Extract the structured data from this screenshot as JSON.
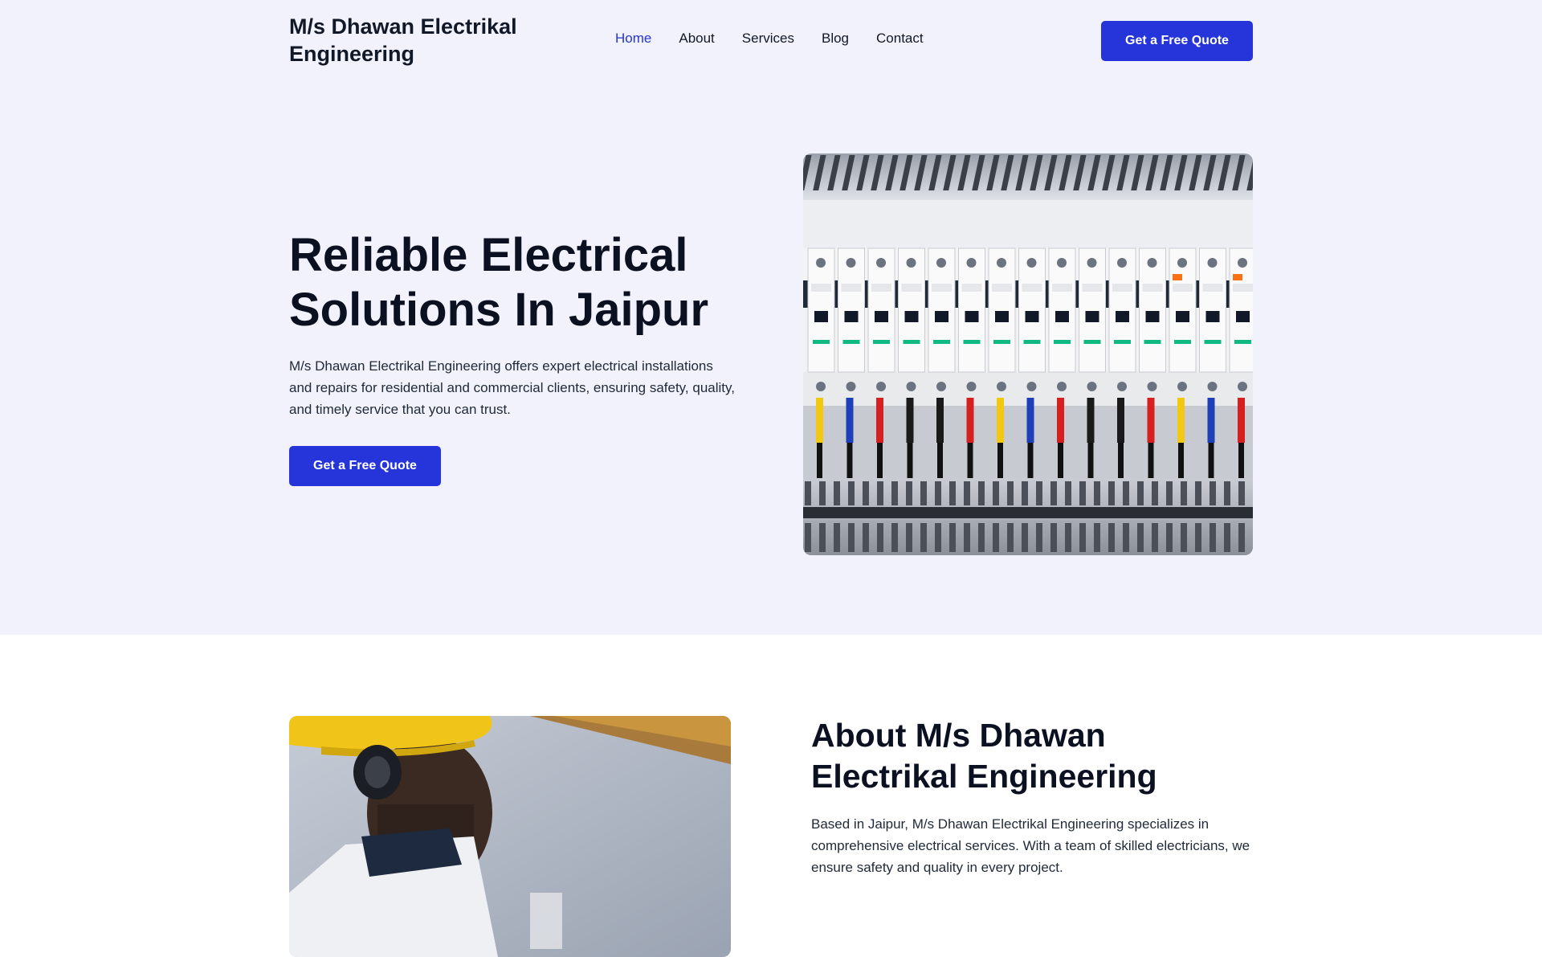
{
  "brand": {
    "name": "M/s Dhawan Electrikal Engineering"
  },
  "nav": {
    "items": [
      {
        "label": "Home",
        "active": true
      },
      {
        "label": "About"
      },
      {
        "label": "Services"
      },
      {
        "label": "Blog"
      },
      {
        "label": "Contact"
      }
    ],
    "cta_label": "Get a Free Quote"
  },
  "hero": {
    "title": "Reliable Electrical Solutions In Jaipur",
    "description": "M/s Dhawan Electrikal Engineering offers expert electrical installations and repairs for residential and commercial clients, ensuring safety, quality, and timely service that you can trust.",
    "cta_label": "Get a Free Quote",
    "image_icon": "circuit-breaker-panel-photo"
  },
  "about": {
    "title": "About M/s Dhawan Electrikal Engineering",
    "description": "Based in Jaipur, M/s Dhawan Electrikal Engineering specializes in comprehensive electrical services. With a team of skilled electricians, we ensure safety and quality in every project.",
    "image_icon": "electrician-hardhat-photo"
  },
  "colors": {
    "accent": "#2535d9",
    "hero_bg": "#f1f2fc",
    "text": "#111827"
  }
}
